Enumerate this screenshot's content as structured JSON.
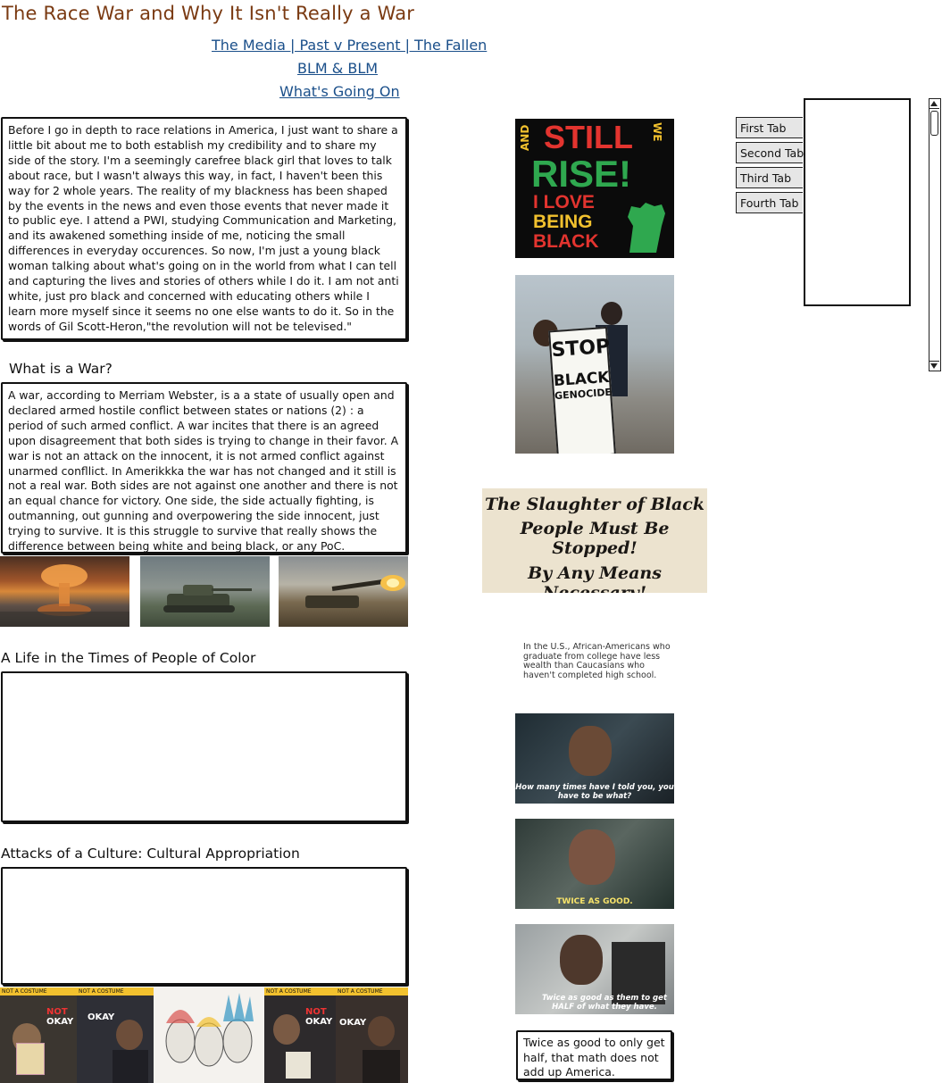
{
  "page": {
    "title": "The Race War and Why It Isn't Really a War"
  },
  "nav": {
    "links": [
      {
        "label": "The Media | Past v Present | The Fallen"
      },
      {
        "label": "BLM & BLM"
      },
      {
        "label": "What's Going On"
      }
    ]
  },
  "intro": {
    "text": "Before I go in depth to race relations in America, I just want to share a little bit about me to both establish my credibility and to share my side of the story. I'm a seemingly carefree black girl that loves to talk about race, but I wasn't always this way, in fact, I haven't been this way for 2 whole years. The reality of my blackness has been shaped by the events in the news and even those events that never made it to public eye. I attend a PWI, studying Communication and Marketing, and its awakened something inside of me, noticing the small differences in everyday occurences. So now, I'm just a young black woman talking about what's going on in the world from what I can tell and capturing the lives and stories of others while I do it. I am not anti white, just pro black and concerned with educating others while I learn more myself since it seems no one else wants to do it. So in the words of Gil Scott-Heron,\"the revolution will not be televised.\""
  },
  "war_section": {
    "heading": "What is a War?",
    "text": "A war, according to Merriam Webster, is a a state of usually open and declared armed hostile conflict between states or nations (2) :  a period of such armed conflict. A war incites that there is an agreed upon disagreement that both sides is trying to change in their favor. A war is not an attack on the innocent, it is not armed conflict against unarmed confllict. In Amerikkka the war has not changed and it still is not a real war. Both sides are not against one another and there is not an equal chance for victory. One side, the side actually fighting, is outmanning, out gunning and overpowering the side innocent, just trying to survive. It is this struggle to survive that really shows the difference between being white and being black, or any PoC."
  },
  "life_section": {
    "heading": "A Life in the Times of People of Color",
    "text": ""
  },
  "culture_section": {
    "heading": "Attacks of a Culture: Cultural Appropriation",
    "text": ""
  },
  "images": {
    "still_we_rise": {
      "side_text": "AND",
      "line1": "STILL",
      "line1_side": "WE",
      "line2": "RISE!",
      "line3": "I LOVE",
      "line4": "BEING",
      "line5": "BLACK"
    },
    "stop_black_genocide": {
      "line1": "STOP",
      "line2": "BLACK",
      "line3": "GENOCIDE"
    },
    "slaughter_poster": {
      "line1": "The Slaughter of Black",
      "line2": "People Must Be Stopped!",
      "line3": "By Any Means Necessary!"
    },
    "wealth_stat": {
      "text": "In the U.S., African-Americans who graduate from college have less wealth than Caucasians who haven't completed high school."
    },
    "gif1": {
      "caption": "How many times have I told you, you have to be what?"
    },
    "gif2": {
      "caption": "TWICE AS GOOD."
    },
    "gif3": {
      "caption": "Twice as good as them to get HALF of what they have."
    },
    "culture_posters": {
      "tag": "NOT A COSTUME",
      "line_a": "NOT",
      "line_b": "OKAY"
    }
  },
  "final_note": {
    "text": "Twice as good to only get half, that math does not add up America."
  },
  "tabs": {
    "items": [
      {
        "label": "First Tab"
      },
      {
        "label": "Second Tab"
      },
      {
        "label": "Third Tab"
      },
      {
        "label": "Fourth Tab"
      }
    ]
  },
  "colors": {
    "title": "#7a3a12",
    "link": "#1a4f8a",
    "rise_green": "#2fa84f",
    "rise_red": "#e3342f",
    "rise_yellow": "#f2c12e"
  }
}
